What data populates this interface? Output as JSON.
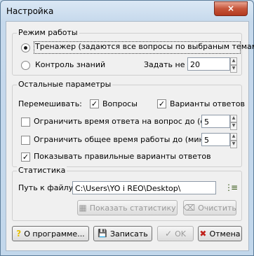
{
  "window": {
    "title": "Настройка",
    "close_glyph": "×"
  },
  "mode": {
    "label": "Режим работы",
    "trainer_label": "Тренажер (задаются все вопросы по выбраным темам)",
    "trainer_selected": true,
    "control_label": "Контроль знаний",
    "control_selected": false,
    "max_label": "Задать не более",
    "max_value": "20"
  },
  "other": {
    "label": "Остальные параметры",
    "shuffle_label": "Перемешивать:",
    "questions_label": "Вопросы",
    "questions_checked": true,
    "answers_label": "Варианты ответов",
    "answers_checked": true,
    "limit_question_label": "Ограничить время ответа на вопрос до (сек)",
    "limit_question_value": "5",
    "limit_question_checked": false,
    "limit_total_label": "Ограничить общее время работы до (мин)",
    "limit_total_value": "5",
    "limit_total_checked": false,
    "show_correct_label": "Показывать правильные варианты ответов",
    "show_correct_checked": true
  },
  "stats": {
    "label": "Статистика",
    "path_label": "Путь к файлу:",
    "path_value": "C:\\Users\\YO i REO\\Desktop\\",
    "show_label": "Показать статистику",
    "clear_label": "Очистить"
  },
  "buttons": {
    "about_label": "О программе...",
    "save_label": "Записать",
    "ok_label": "OK",
    "cancel_label": "Отмена"
  },
  "icons": {
    "check_mark": "✓",
    "question": "?",
    "save": "💾",
    "ok": "✓",
    "cancel": "✖",
    "folder": "⋮≡",
    "stats": "▦",
    "clear": "⌫"
  },
  "colors": {
    "close_button": "#c6553a",
    "cancel_icon": "#c0201a",
    "question_icon": "#e8c000"
  }
}
